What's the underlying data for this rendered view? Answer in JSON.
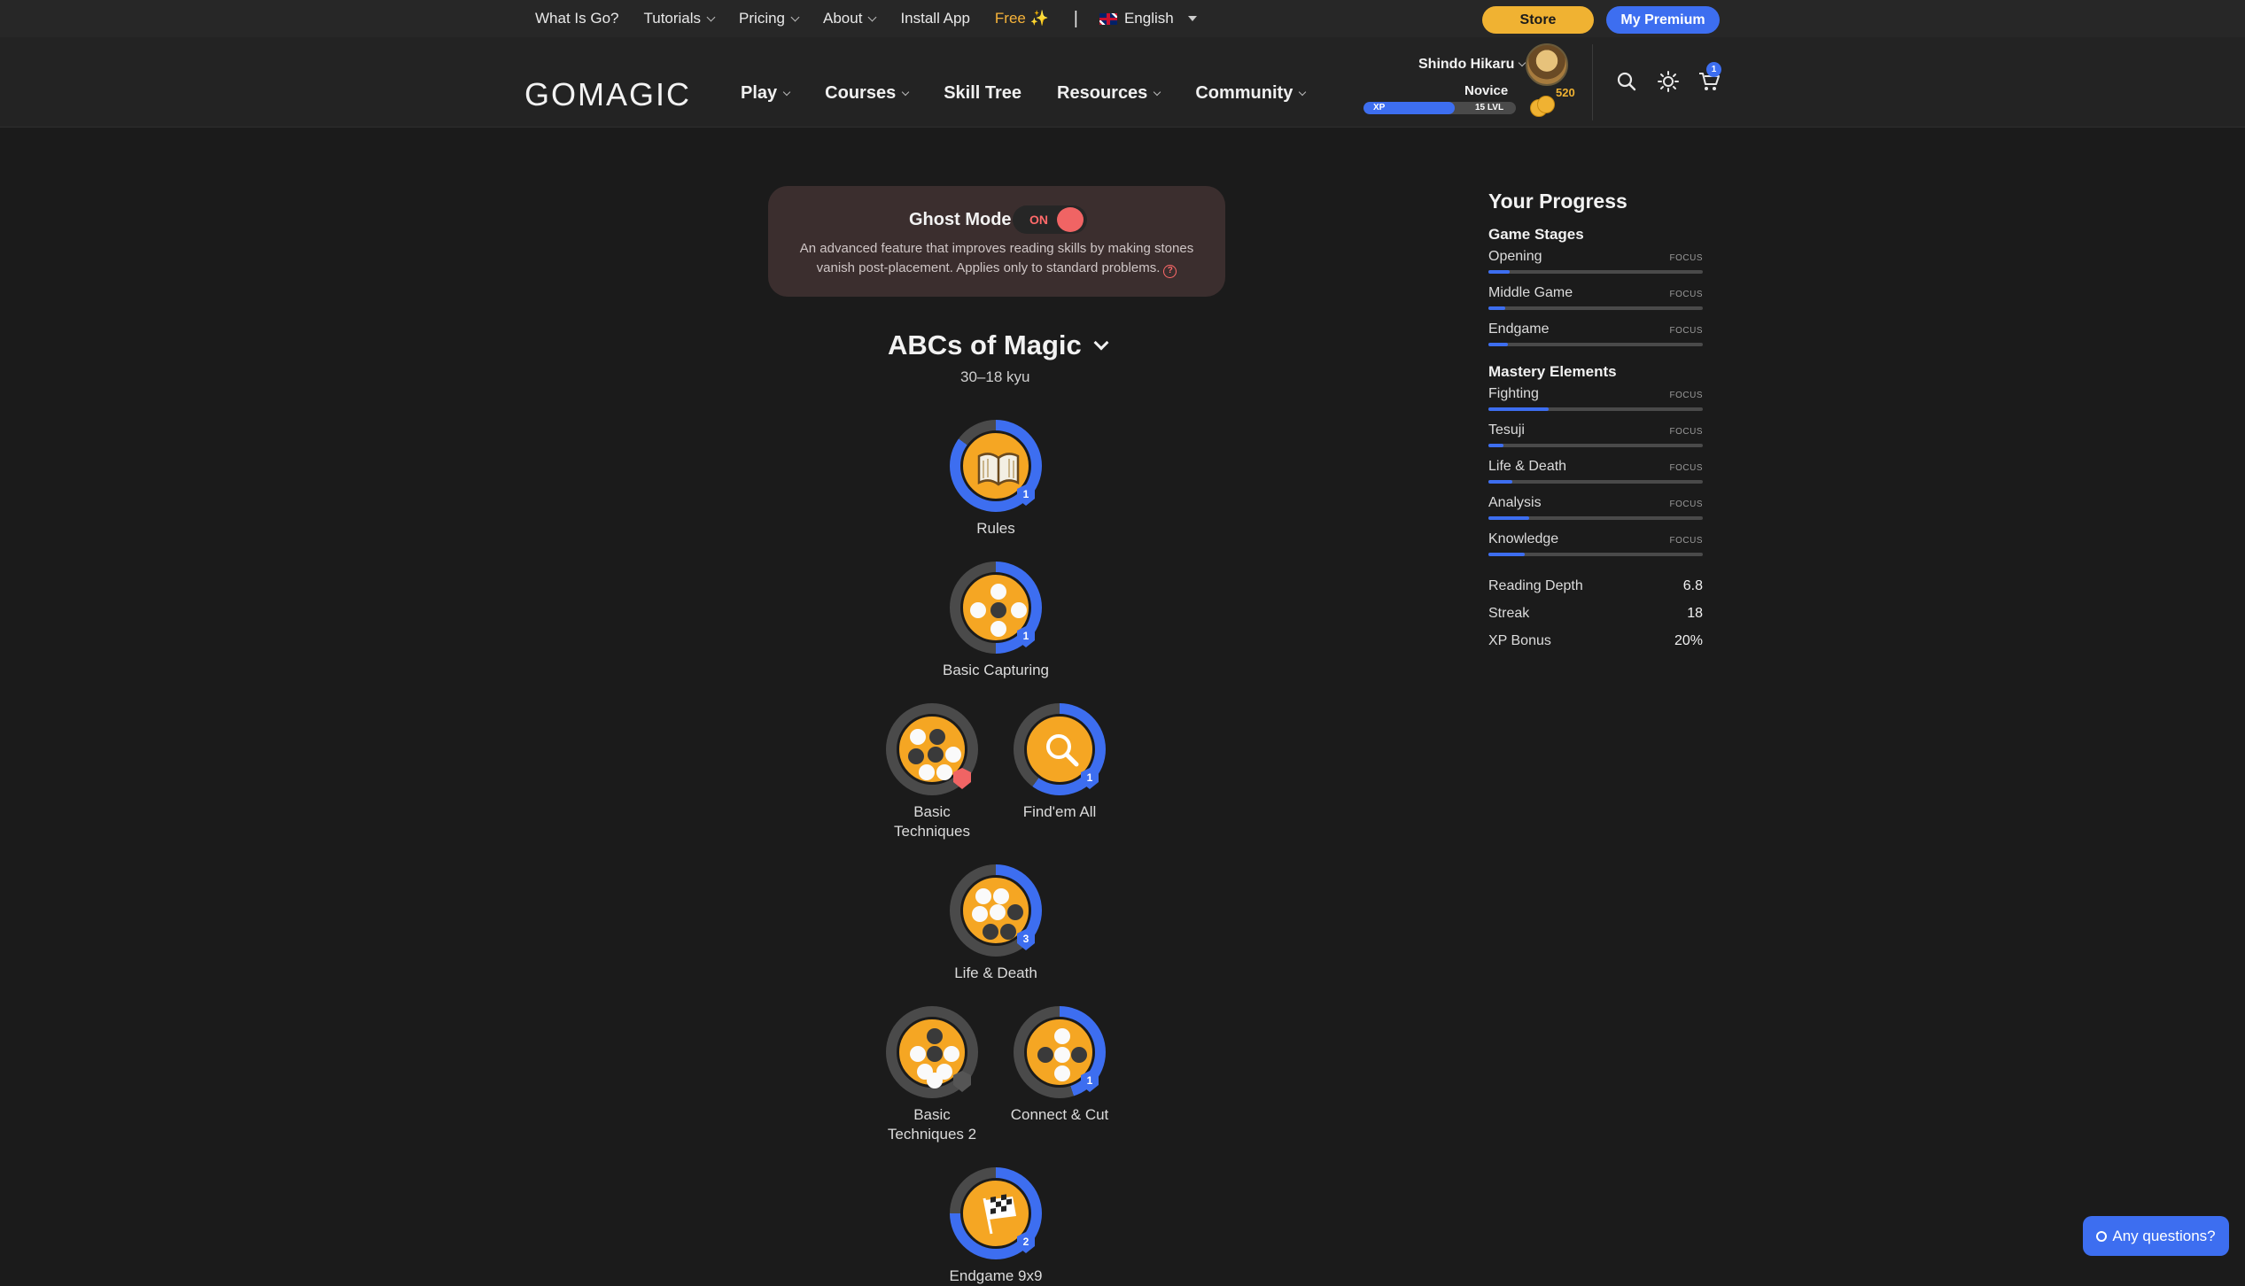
{
  "topbar": {
    "links": [
      {
        "label": "What Is Go?",
        "has_menu": false
      },
      {
        "label": "Tutorials",
        "has_menu": true
      },
      {
        "label": "Pricing",
        "has_menu": true
      },
      {
        "label": "About",
        "has_menu": true
      },
      {
        "label": "Install App",
        "has_menu": false
      }
    ],
    "free_label": "Free ✨",
    "separator": "|",
    "language": "English",
    "store_label": "Store",
    "premium_label": "My Premium"
  },
  "header": {
    "logo": "GOMAGIC",
    "nav": [
      {
        "label": "Play",
        "has_menu": true
      },
      {
        "label": "Courses",
        "has_menu": true
      },
      {
        "label": "Skill Tree",
        "has_menu": false
      },
      {
        "label": "Resources",
        "has_menu": true
      },
      {
        "label": "Community",
        "has_menu": true
      }
    ],
    "user": {
      "name": "Shindo Hikaru",
      "rank": "Novice",
      "xp_label": "XP",
      "level_label": "15 LVL",
      "xp_fraction": 0.6,
      "coins": "520"
    },
    "cart_count": "1"
  },
  "ghost_mode": {
    "title": "Ghost Mode",
    "toggle_label": "ON",
    "description": "An advanced feature that improves reading skills by making stones vanish post-placement. Applies only to standard problems."
  },
  "course": {
    "title": "ABCs of Magic",
    "subtitle": "30–18 kyu",
    "nodes": [
      {
        "label": "Rules",
        "badge": "1",
        "badge_color": "#3d6ef0",
        "progress": 0.85,
        "icon": "book-icon"
      },
      {
        "label": "Basic Capturing",
        "badge": "1",
        "badge_color": "#3d6ef0",
        "progress": 0.5,
        "icon": "capture-stones-icon"
      },
      {
        "label": "Basic Techniques",
        "badge": "",
        "badge_color": "#f06464",
        "progress": 0.0,
        "icon": "technique-stones-icon"
      },
      {
        "label": "Find'em All",
        "badge": "1",
        "badge_color": "#3d6ef0",
        "progress": 0.6,
        "icon": "magnifier-icon"
      },
      {
        "label": "Life & Death",
        "badge": "3",
        "badge_color": "#3d6ef0",
        "progress": 0.4,
        "icon": "life-death-stones-icon"
      },
      {
        "label": "Basic Techniques 2",
        "badge": "",
        "badge_color": "#555555",
        "progress": 0.0,
        "icon": "technique-stones-2-icon"
      },
      {
        "label": "Connect & Cut",
        "badge": "1",
        "badge_color": "#3d6ef0",
        "progress": 0.45,
        "icon": "connect-cut-stones-icon"
      },
      {
        "label": "Endgame 9x9",
        "badge": "2",
        "badge_color": "#3d6ef0",
        "progress": 0.75,
        "icon": "checkered-flag-icon"
      }
    ]
  },
  "progress": {
    "title": "Your Progress",
    "focus_label": "FOCUS",
    "game_stages_title": "Game Stages",
    "game_stages": [
      {
        "name": "Opening",
        "value": 0.1
      },
      {
        "name": "Middle Game",
        "value": 0.08
      },
      {
        "name": "Endgame",
        "value": 0.09
      }
    ],
    "mastery_title": "Mastery Elements",
    "mastery": [
      {
        "name": "Fighting",
        "value": 0.28
      },
      {
        "name": "Tesuji",
        "value": 0.07
      },
      {
        "name": "Life & Death",
        "value": 0.11
      },
      {
        "name": "Analysis",
        "value": 0.19
      },
      {
        "name": "Knowledge",
        "value": 0.17
      }
    ],
    "stats": [
      {
        "name": "Reading Depth",
        "value": "6.8"
      },
      {
        "name": "Streak",
        "value": "18"
      },
      {
        "name": "XP Bonus",
        "value": "20%"
      }
    ]
  },
  "help_label": "Any questions?",
  "colors": {
    "accent": "#3d6ef0",
    "gold": "#f0b232",
    "node_fill": "#f5a623",
    "danger": "#f06464"
  }
}
